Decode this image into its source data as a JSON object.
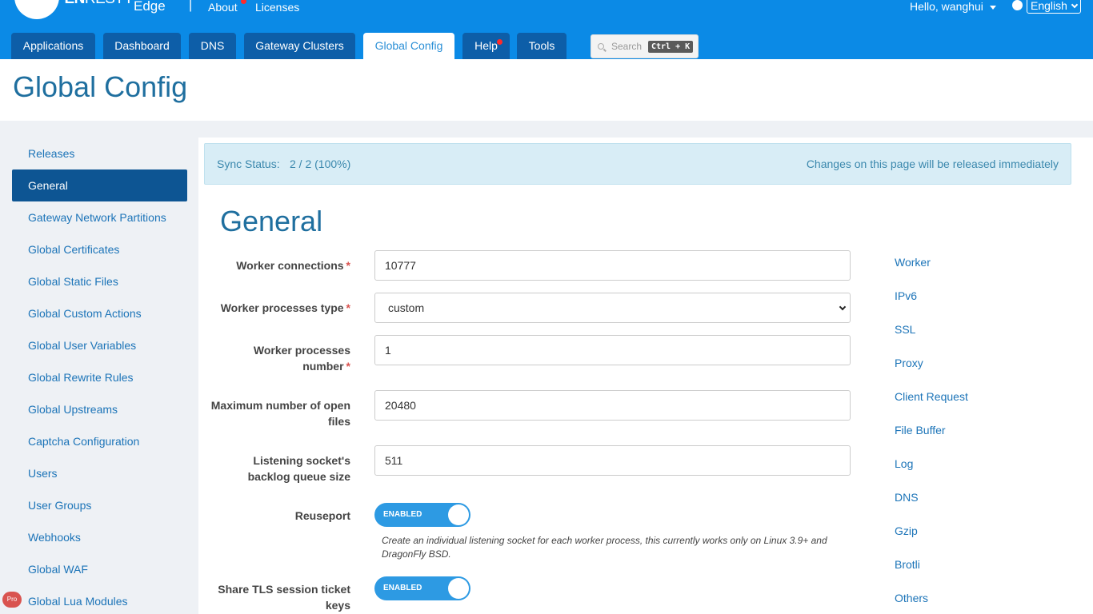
{
  "topbar": {
    "logo_bold": "OPEN",
    "logo_thin": "RESTY",
    "logo_edge": "Edge",
    "about": "About",
    "licenses": "Licenses",
    "user_greeting": "Hello, wanghui",
    "language": "English",
    "brand_color": "#0b8ae6"
  },
  "tabs": [
    {
      "label": "Applications"
    },
    {
      "label": "Dashboard"
    },
    {
      "label": "DNS"
    },
    {
      "label": "Gateway Clusters"
    },
    {
      "label": "Global Config"
    },
    {
      "label": "Help"
    },
    {
      "label": "Tools"
    }
  ],
  "search": {
    "placeholder": "Search",
    "shortcut": "Ctrl + K"
  },
  "page": {
    "title": "Global Config"
  },
  "sidebar": {
    "items": [
      {
        "label": "Releases"
      },
      {
        "label": "General"
      },
      {
        "label": "Gateway Network Partitions"
      },
      {
        "label": "Global Certificates"
      },
      {
        "label": "Global Static Files"
      },
      {
        "label": "Global Custom Actions"
      },
      {
        "label": "Global User Variables"
      },
      {
        "label": "Global Rewrite Rules"
      },
      {
        "label": "Global Upstreams"
      },
      {
        "label": "Captcha Configuration"
      },
      {
        "label": "Users"
      },
      {
        "label": "User Groups"
      },
      {
        "label": "Webhooks"
      },
      {
        "label": "Global WAF"
      },
      {
        "label": "Global Lua Modules"
      }
    ],
    "active": "General",
    "pro_badge": "Pro"
  },
  "sync": {
    "label": "Sync Status:",
    "value": "2 / 2 (100%)",
    "note": "Changes on this page will be released immediately"
  },
  "form": {
    "title": "General",
    "worker_connections": {
      "label": "Worker connections",
      "value": "10777"
    },
    "worker_processes_type": {
      "label": "Worker processes type",
      "value": "custom"
    },
    "worker_processes_number": {
      "label_line1": "Worker processes",
      "label_line2": "number",
      "value": "1"
    },
    "max_open_files": {
      "label_line1": "Maximum number of open",
      "label_line2": "files",
      "value": "20480"
    },
    "backlog": {
      "label_line1": "Listening socket's",
      "label_line2": "backlog queue size",
      "value": "511"
    },
    "reuseport": {
      "label": "Reuseport",
      "state": "ENABLED",
      "help": "Create an individual listening socket for each worker process, this currently works only on Linux 3.9+ and DragonFly BSD."
    },
    "tls_ticket": {
      "label_line1": "Share TLS session ticket",
      "label_line2": "keys",
      "state": "ENABLED"
    }
  },
  "anchors": [
    "Worker",
    "IPv6",
    "SSL",
    "Proxy",
    "Client Request",
    "File Buffer",
    "Log",
    "DNS",
    "Gzip",
    "Brotli",
    "Others"
  ]
}
